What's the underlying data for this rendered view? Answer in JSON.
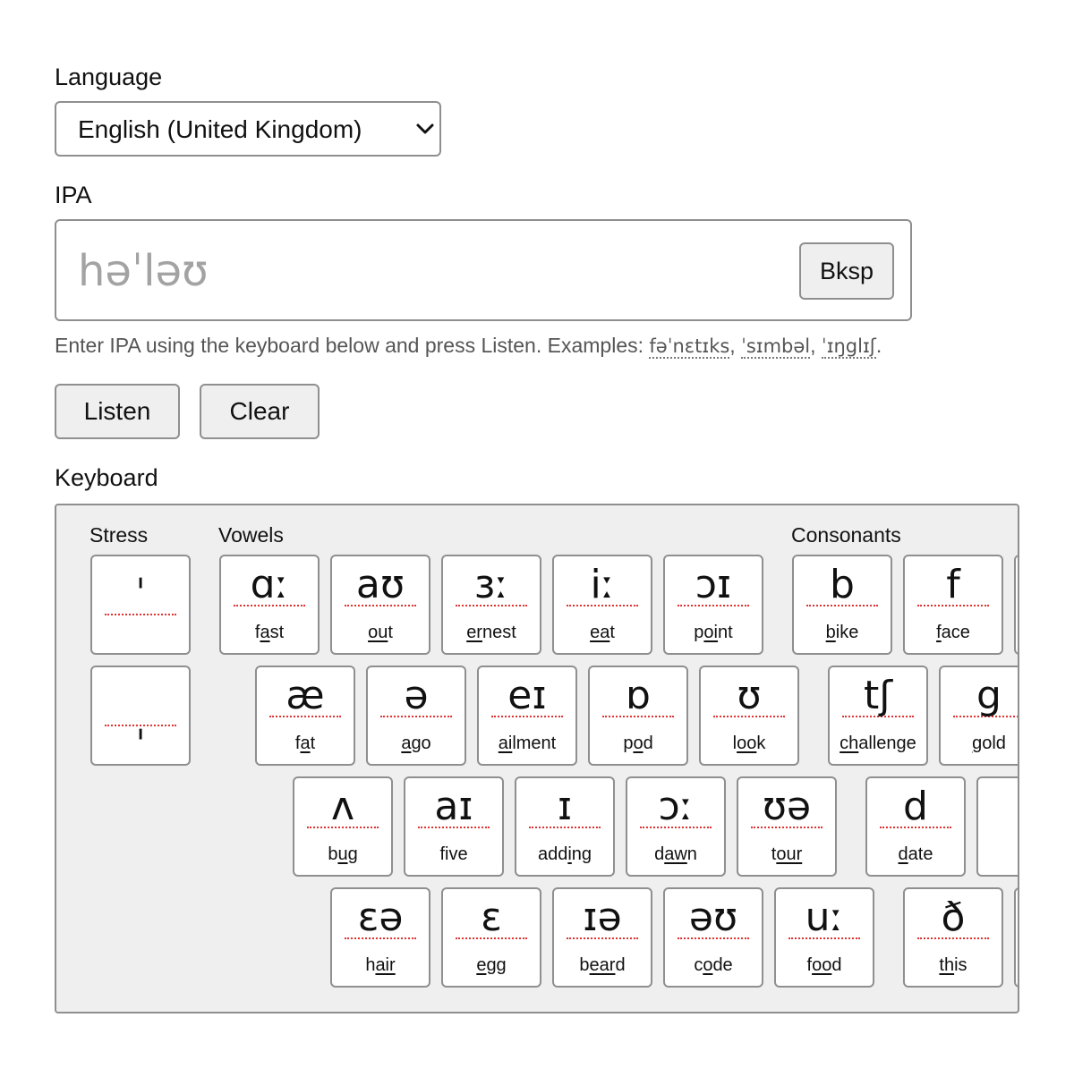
{
  "language": {
    "label": "Language",
    "selected": "English (United Kingdom)",
    "options": [
      "English (United Kingdom)"
    ]
  },
  "ipa": {
    "label": "IPA",
    "placeholder": "həˈləʊ",
    "value": "",
    "backspace_label": "Bksp",
    "hint_prefix": "Enter IPA using the keyboard below and press Listen. Examples: ",
    "examples": [
      "fəˈnɛtɪks",
      "ˈsɪmbəl",
      "ˈɪŋglɪʃ"
    ],
    "separator": ", ",
    "hint_end": "."
  },
  "actions": {
    "listen_label": "Listen",
    "clear_label": "Clear"
  },
  "keyboard": {
    "label": "Keyboard",
    "sections": {
      "stress": "Stress",
      "vowels": "Vowels",
      "consonants": "Consonants"
    },
    "stress": [
      {
        "symbol": "ˈ",
        "name": "primary-stress"
      },
      {
        "symbol": "ˌ",
        "name": "secondary-stress"
      }
    ],
    "vowels": [
      [
        {
          "symbol": "ɑː",
          "pre": "f",
          "u": "a",
          "post": "st"
        },
        {
          "symbol": "aʊ",
          "pre": "",
          "u": "ou",
          "post": "t"
        },
        {
          "symbol": "ɜː",
          "pre": "",
          "u": "er",
          "post": "nest"
        },
        {
          "symbol": "iː",
          "pre": "",
          "u": "ea",
          "post": "t"
        },
        {
          "symbol": "ɔɪ",
          "pre": "p",
          "u": "oi",
          "post": "nt"
        }
      ],
      [
        {
          "symbol": "æ",
          "pre": "f",
          "u": "a",
          "post": "t"
        },
        {
          "symbol": "ə",
          "pre": "",
          "u": "a",
          "post": "go"
        },
        {
          "symbol": "eɪ",
          "pre": "",
          "u": "ai",
          "post": "lment"
        },
        {
          "symbol": "ɒ",
          "pre": "p",
          "u": "o",
          "post": "d"
        },
        {
          "symbol": "ʊ",
          "pre": "l",
          "u": "oo",
          "post": "k"
        }
      ],
      [
        {
          "symbol": "ʌ",
          "pre": "b",
          "u": "u",
          "post": "g"
        },
        {
          "symbol": "aɪ",
          "pre": "five",
          "u": "",
          "post": ""
        },
        {
          "symbol": "ɪ",
          "pre": "add",
          "u": "i",
          "post": "ng"
        },
        {
          "symbol": "ɔː",
          "pre": "d",
          "u": "aw",
          "post": "n"
        },
        {
          "symbol": "ʊə",
          "pre": "t",
          "u": "our",
          "post": ""
        }
      ],
      [
        {
          "symbol": "ɛə",
          "pre": "h",
          "u": "air",
          "post": ""
        },
        {
          "symbol": "ɛ",
          "pre": "",
          "u": "e",
          "post": "gg"
        },
        {
          "symbol": "ɪə",
          "pre": "b",
          "u": "ear",
          "post": "d"
        },
        {
          "symbol": "əʊ",
          "pre": "c",
          "u": "o",
          "post": "de"
        },
        {
          "symbol": "uː",
          "pre": "f",
          "u": "oo",
          "post": "d"
        }
      ]
    ],
    "consonants": [
      [
        {
          "symbol": "b",
          "pre": "",
          "u": "b",
          "post": "ike"
        },
        {
          "symbol": "f",
          "pre": "",
          "u": "f",
          "post": "ace"
        }
      ],
      [
        {
          "symbol": "tʃ",
          "pre": "",
          "u": "ch",
          "post": "allenge"
        },
        {
          "symbol": "g",
          "pre": "",
          "u": "g",
          "post": "old"
        }
      ],
      [
        {
          "symbol": "d",
          "pre": "",
          "u": "d",
          "post": "ate"
        }
      ],
      [
        {
          "symbol": "ð",
          "pre": "",
          "u": "th",
          "post": "is"
        }
      ]
    ]
  }
}
